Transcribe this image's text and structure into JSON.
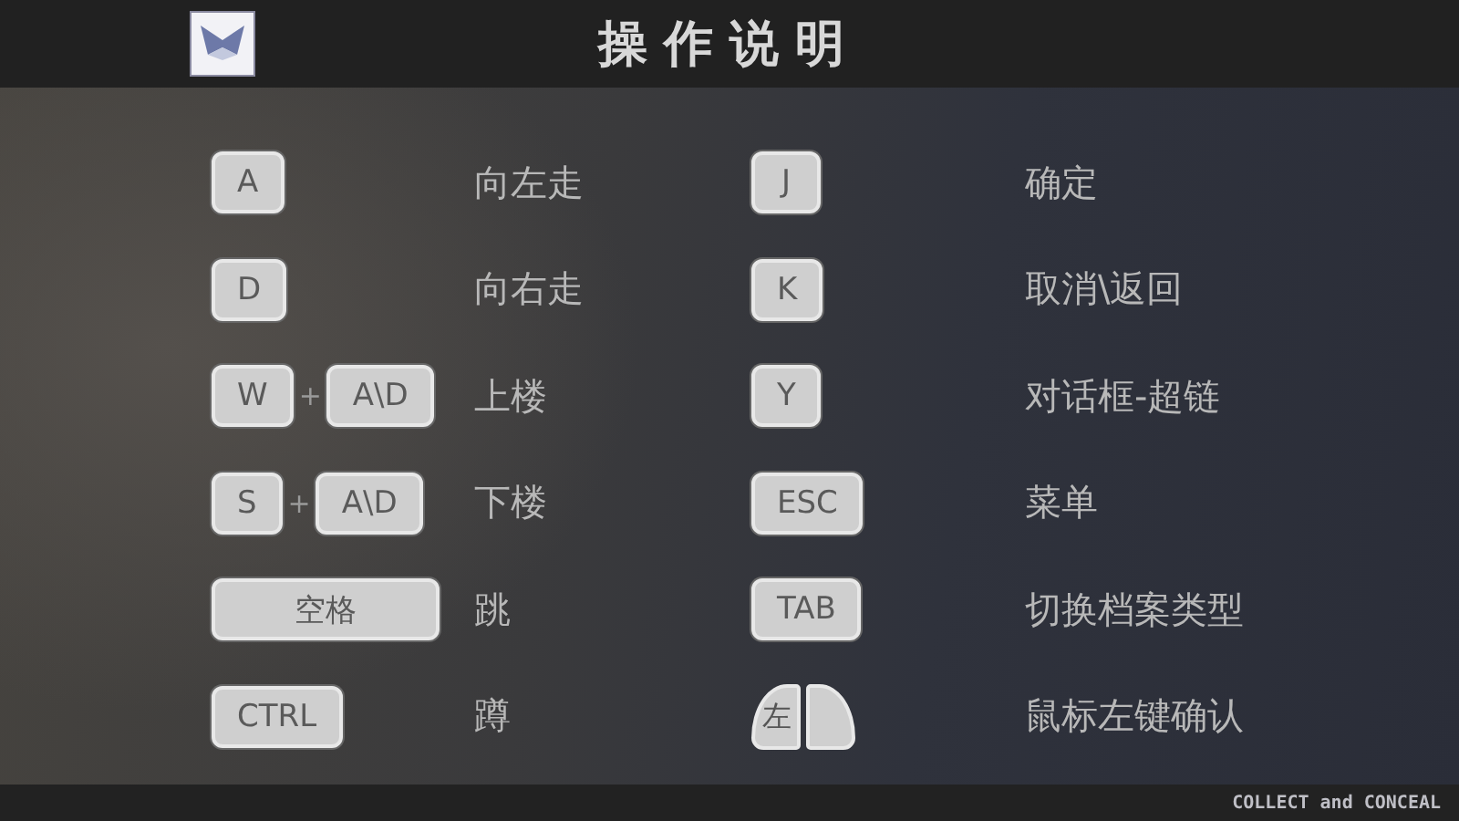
{
  "header": {
    "title": "操作说明"
  },
  "left_controls": [
    {
      "keys": [
        {
          "kind": "key",
          "label": "A"
        }
      ],
      "action": "向左走"
    },
    {
      "keys": [
        {
          "kind": "key",
          "label": "D"
        }
      ],
      "action": "向右走"
    },
    {
      "keys": [
        {
          "kind": "key",
          "label": "W"
        },
        {
          "kind": "key",
          "label": "A\\D"
        }
      ],
      "joiner": "+",
      "action": "上楼"
    },
    {
      "keys": [
        {
          "kind": "key",
          "label": "S"
        },
        {
          "kind": "key",
          "label": "A\\D"
        }
      ],
      "joiner": "+",
      "action": "下楼"
    },
    {
      "keys": [
        {
          "kind": "wide-key",
          "label": "空格"
        }
      ],
      "action": "跳"
    },
    {
      "keys": [
        {
          "kind": "key",
          "label": "CTRL"
        }
      ],
      "action": "蹲"
    }
  ],
  "right_controls": [
    {
      "keys": [
        {
          "kind": "key",
          "label": "J"
        }
      ],
      "action": "确定"
    },
    {
      "keys": [
        {
          "kind": "key",
          "label": "K"
        }
      ],
      "action": "取消\\返回"
    },
    {
      "keys": [
        {
          "kind": "key",
          "label": "Y"
        }
      ],
      "action": "对话框-超链"
    },
    {
      "keys": [
        {
          "kind": "key",
          "label": "ESC"
        }
      ],
      "action": "菜单"
    },
    {
      "keys": [
        {
          "kind": "key",
          "label": "TAB"
        }
      ],
      "action": "切换档案类型"
    },
    {
      "keys": [
        {
          "kind": "mouse",
          "label": "左"
        }
      ],
      "action": "鼠标左键确认"
    }
  ],
  "footer": {
    "brand": "COLLECT and CONCEAL"
  }
}
